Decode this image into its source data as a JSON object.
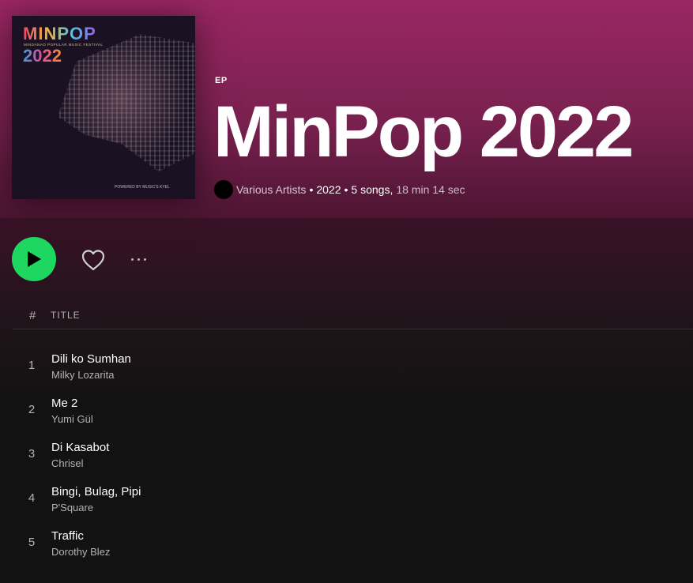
{
  "album": {
    "type": "EP",
    "title": "MinPop 2022",
    "artist": "Various Artists",
    "year": "2022",
    "song_count": "5 songs,",
    "duration": "18 min 14 sec",
    "separator": "•",
    "cover": {
      "logo_text": "MINPOP",
      "subtitle": "MINDANAO POPULAR MUSIC FESTIVAL",
      "year_text": "2022",
      "footer": "POWERED BY MUSIC'S KYEL"
    }
  },
  "controls": {
    "play_icon": "play-icon",
    "like_icon": "heart-outline-icon",
    "more_icon": "more-horizontal-icon",
    "play_color": "#1ed760"
  },
  "table": {
    "hash_label": "#",
    "title_label": "TITLE"
  },
  "tracks": [
    {
      "number": "1",
      "title": "Dili ko Sumhan",
      "artist": "Milky Lozarita"
    },
    {
      "number": "2",
      "title": "Me 2",
      "artist": "Yumi Gül"
    },
    {
      "number": "3",
      "title": "Di Kasabot",
      "artist": "Chrisel"
    },
    {
      "number": "4",
      "title": "Bingi, Bulag, Pipi",
      "artist": "P'Square"
    },
    {
      "number": "5",
      "title": "Traffic",
      "artist": "Dorothy Blez"
    }
  ],
  "colors": {
    "header_top": "#9a2663",
    "background": "#121212",
    "accent": "#1ed760"
  }
}
